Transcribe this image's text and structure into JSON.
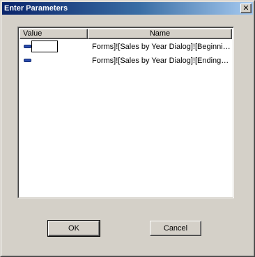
{
  "window": {
    "title": "Enter Parameters",
    "close_glyph": "✕",
    "title_gradient": [
      "#0a246a",
      "#a6caf0"
    ],
    "face_color": "#d4d0c8"
  },
  "list": {
    "columns": [
      "Value",
      "Name"
    ],
    "rows": [
      {
        "icon": "parameter-icon",
        "value": "",
        "name": "Forms]![Sales by Year Dialog]![Beginning Date]"
      },
      {
        "icon": "parameter-icon",
        "value": "",
        "name": "Forms]![Sales by Year Dialog]![Ending Date]"
      }
    ]
  },
  "buttons": {
    "ok_label": "OK",
    "cancel_label": "Cancel"
  }
}
